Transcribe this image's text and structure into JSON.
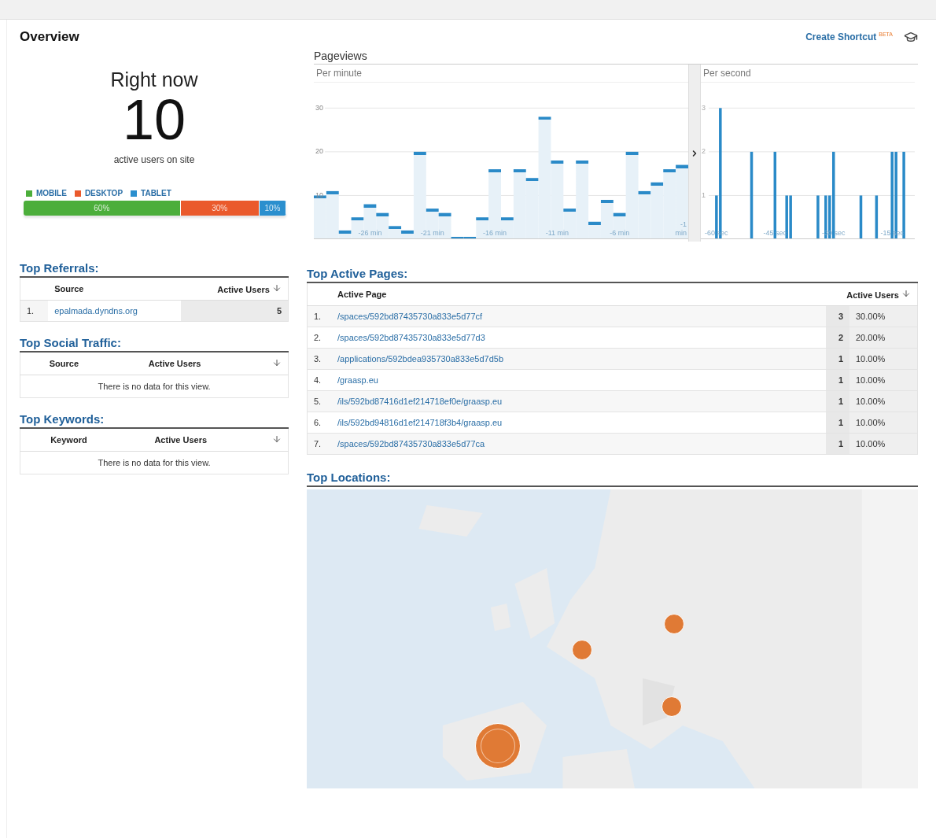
{
  "header": {
    "title": "Overview",
    "shortcut": "Create Shortcut",
    "beta": "BETA"
  },
  "right_now": {
    "title": "Right now",
    "count": "10",
    "caption": "active users on site",
    "devices": [
      {
        "label": "MOBILE",
        "color": "#4cae3b",
        "reading": "60%"
      },
      {
        "label": "DESKTOP",
        "color": "#ea5a2c",
        "reading": "30%"
      },
      {
        "label": "TABLET",
        "color": "#2b8fce",
        "reading": "10%"
      }
    ]
  },
  "pageviews": {
    "title": "Pageviews",
    "per_minute": {
      "chart_data": {
        "type": "bar",
        "title": "Per minute",
        "x": [
          -30,
          -29,
          -28,
          -27,
          -26,
          -25,
          -24,
          -23,
          -22,
          -21,
          -20,
          -19,
          -18,
          -17,
          -16,
          -15,
          -14,
          -13,
          -12,
          -11,
          -10,
          -9,
          -8,
          -7,
          -6,
          -5,
          -4,
          -3,
          -2,
          -1
        ],
        "values": [
          10,
          11,
          2,
          5,
          8,
          6,
          3,
          2,
          20,
          7,
          6,
          0,
          0,
          5,
          16,
          5,
          16,
          14,
          28,
          18,
          7,
          18,
          4,
          9,
          6,
          20,
          11,
          13,
          16,
          17
        ],
        "xlim": [
          -30.5,
          -0.5
        ],
        "ylim": [
          0,
          36
        ],
        "grid": true,
        "yticks": [
          10,
          20,
          30
        ],
        "xticks": [
          {
            "value": -26,
            "label": "-26 min"
          },
          {
            "value": -21,
            "label": "-21 min"
          },
          {
            "value": -16,
            "label": "-16 min"
          },
          {
            "value": -11,
            "label": "-11 min"
          },
          {
            "value": -6,
            "label": "-6 min"
          },
          {
            "value": -1,
            "label": "-1 min"
          }
        ]
      }
    },
    "per_second": {
      "chart_data": {
        "type": "bar",
        "title": "Per second",
        "x": [
          -60,
          -59,
          -51,
          -45,
          -42,
          -41,
          -34,
          -32,
          -31,
          -30,
          -23,
          -19,
          -15,
          -14,
          -12
        ],
        "values": [
          1,
          3,
          2,
          2,
          1,
          1,
          1,
          1,
          1,
          2,
          1,
          1,
          2,
          2,
          2
        ],
        "xlim": [
          -64,
          -9.2
        ],
        "ylim": [
          0,
          3.6
        ],
        "grid": true,
        "yticks": [
          1,
          2,
          3
        ],
        "xticks": [
          {
            "value": -60,
            "label": "-60 sec"
          },
          {
            "value": -45,
            "label": "-45 sec"
          },
          {
            "value": -30,
            "label": "-30 sec"
          },
          {
            "value": -15,
            "label": "-15 sec"
          }
        ]
      }
    }
  },
  "top_referrals": {
    "title": "Top Referrals:",
    "columns": [
      "Source",
      "Active Users"
    ],
    "rows": [
      {
        "index": "1.",
        "source": "epalmada.dyndns.org",
        "users": "5"
      }
    ]
  },
  "top_social": {
    "title": "Top Social Traffic:",
    "columns": [
      "Source",
      "Active Users"
    ],
    "empty": "There is no data for this view."
  },
  "top_keywords": {
    "title": "Top Keywords:",
    "columns": [
      "Keyword",
      "Active Users"
    ],
    "empty": "There is no data for this view."
  },
  "top_pages": {
    "title": "Top Active Pages:",
    "columns": [
      "Active Page",
      "Active Users"
    ],
    "rows": [
      {
        "index": "1.",
        "page": "/spaces/592bd87435730a833e5d77cf",
        "users": "3",
        "share": "30.00%"
      },
      {
        "index": "2.",
        "page": "/spaces/592bd87435730a833e5d77d3",
        "users": "2",
        "share": "20.00%"
      },
      {
        "index": "3.",
        "page": "/applications/592bdea935730a833e5d7d5b",
        "users": "1",
        "share": "10.00%"
      },
      {
        "index": "4.",
        "page": "/graasp.eu",
        "users": "1",
        "share": "10.00%"
      },
      {
        "index": "5.",
        "page": "/ils/592bd87416d1ef214718ef0e/graasp.eu",
        "users": "1",
        "share": "10.00%"
      },
      {
        "index": "6.",
        "page": "/ils/592bd94816d1ef214718f3b4/graasp.eu",
        "users": "1",
        "share": "10.00%"
      },
      {
        "index": "7.",
        "page": "/spaces/592bd87435730a833e5d77ca",
        "users": "1",
        "share": "10.00%"
      }
    ]
  },
  "top_locations": {
    "title": "Top Locations:"
  }
}
